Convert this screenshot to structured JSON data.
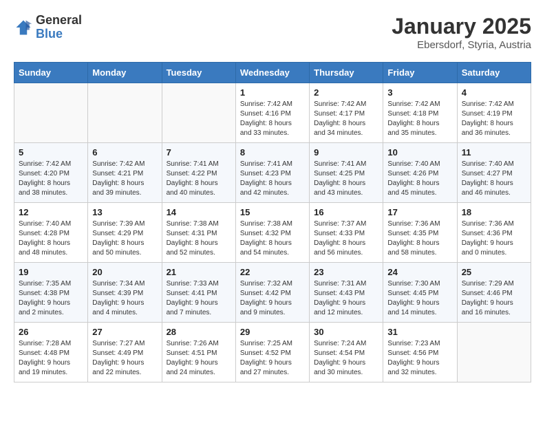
{
  "logo": {
    "general": "General",
    "blue": "Blue"
  },
  "title": "January 2025",
  "subtitle": "Ebersdorf, Styria, Austria",
  "headers": [
    "Sunday",
    "Monday",
    "Tuesday",
    "Wednesday",
    "Thursday",
    "Friday",
    "Saturday"
  ],
  "weeks": [
    [
      {
        "day": "",
        "info": ""
      },
      {
        "day": "",
        "info": ""
      },
      {
        "day": "",
        "info": ""
      },
      {
        "day": "1",
        "info": "Sunrise: 7:42 AM\nSunset: 4:16 PM\nDaylight: 8 hours\nand 33 minutes."
      },
      {
        "day": "2",
        "info": "Sunrise: 7:42 AM\nSunset: 4:17 PM\nDaylight: 8 hours\nand 34 minutes."
      },
      {
        "day": "3",
        "info": "Sunrise: 7:42 AM\nSunset: 4:18 PM\nDaylight: 8 hours\nand 35 minutes."
      },
      {
        "day": "4",
        "info": "Sunrise: 7:42 AM\nSunset: 4:19 PM\nDaylight: 8 hours\nand 36 minutes."
      }
    ],
    [
      {
        "day": "5",
        "info": "Sunrise: 7:42 AM\nSunset: 4:20 PM\nDaylight: 8 hours\nand 38 minutes."
      },
      {
        "day": "6",
        "info": "Sunrise: 7:42 AM\nSunset: 4:21 PM\nDaylight: 8 hours\nand 39 minutes."
      },
      {
        "day": "7",
        "info": "Sunrise: 7:41 AM\nSunset: 4:22 PM\nDaylight: 8 hours\nand 40 minutes."
      },
      {
        "day": "8",
        "info": "Sunrise: 7:41 AM\nSunset: 4:23 PM\nDaylight: 8 hours\nand 42 minutes."
      },
      {
        "day": "9",
        "info": "Sunrise: 7:41 AM\nSunset: 4:25 PM\nDaylight: 8 hours\nand 43 minutes."
      },
      {
        "day": "10",
        "info": "Sunrise: 7:40 AM\nSunset: 4:26 PM\nDaylight: 8 hours\nand 45 minutes."
      },
      {
        "day": "11",
        "info": "Sunrise: 7:40 AM\nSunset: 4:27 PM\nDaylight: 8 hours\nand 46 minutes."
      }
    ],
    [
      {
        "day": "12",
        "info": "Sunrise: 7:40 AM\nSunset: 4:28 PM\nDaylight: 8 hours\nand 48 minutes."
      },
      {
        "day": "13",
        "info": "Sunrise: 7:39 AM\nSunset: 4:29 PM\nDaylight: 8 hours\nand 50 minutes."
      },
      {
        "day": "14",
        "info": "Sunrise: 7:38 AM\nSunset: 4:31 PM\nDaylight: 8 hours\nand 52 minutes."
      },
      {
        "day": "15",
        "info": "Sunrise: 7:38 AM\nSunset: 4:32 PM\nDaylight: 8 hours\nand 54 minutes."
      },
      {
        "day": "16",
        "info": "Sunrise: 7:37 AM\nSunset: 4:33 PM\nDaylight: 8 hours\nand 56 minutes."
      },
      {
        "day": "17",
        "info": "Sunrise: 7:36 AM\nSunset: 4:35 PM\nDaylight: 8 hours\nand 58 minutes."
      },
      {
        "day": "18",
        "info": "Sunrise: 7:36 AM\nSunset: 4:36 PM\nDaylight: 9 hours\nand 0 minutes."
      }
    ],
    [
      {
        "day": "19",
        "info": "Sunrise: 7:35 AM\nSunset: 4:38 PM\nDaylight: 9 hours\nand 2 minutes."
      },
      {
        "day": "20",
        "info": "Sunrise: 7:34 AM\nSunset: 4:39 PM\nDaylight: 9 hours\nand 4 minutes."
      },
      {
        "day": "21",
        "info": "Sunrise: 7:33 AM\nSunset: 4:41 PM\nDaylight: 9 hours\nand 7 minutes."
      },
      {
        "day": "22",
        "info": "Sunrise: 7:32 AM\nSunset: 4:42 PM\nDaylight: 9 hours\nand 9 minutes."
      },
      {
        "day": "23",
        "info": "Sunrise: 7:31 AM\nSunset: 4:43 PM\nDaylight: 9 hours\nand 12 minutes."
      },
      {
        "day": "24",
        "info": "Sunrise: 7:30 AM\nSunset: 4:45 PM\nDaylight: 9 hours\nand 14 minutes."
      },
      {
        "day": "25",
        "info": "Sunrise: 7:29 AM\nSunset: 4:46 PM\nDaylight: 9 hours\nand 16 minutes."
      }
    ],
    [
      {
        "day": "26",
        "info": "Sunrise: 7:28 AM\nSunset: 4:48 PM\nDaylight: 9 hours\nand 19 minutes."
      },
      {
        "day": "27",
        "info": "Sunrise: 7:27 AM\nSunset: 4:49 PM\nDaylight: 9 hours\nand 22 minutes."
      },
      {
        "day": "28",
        "info": "Sunrise: 7:26 AM\nSunset: 4:51 PM\nDaylight: 9 hours\nand 24 minutes."
      },
      {
        "day": "29",
        "info": "Sunrise: 7:25 AM\nSunset: 4:52 PM\nDaylight: 9 hours\nand 27 minutes."
      },
      {
        "day": "30",
        "info": "Sunrise: 7:24 AM\nSunset: 4:54 PM\nDaylight: 9 hours\nand 30 minutes."
      },
      {
        "day": "31",
        "info": "Sunrise: 7:23 AM\nSunset: 4:56 PM\nDaylight: 9 hours\nand 32 minutes."
      },
      {
        "day": "",
        "info": ""
      }
    ]
  ]
}
